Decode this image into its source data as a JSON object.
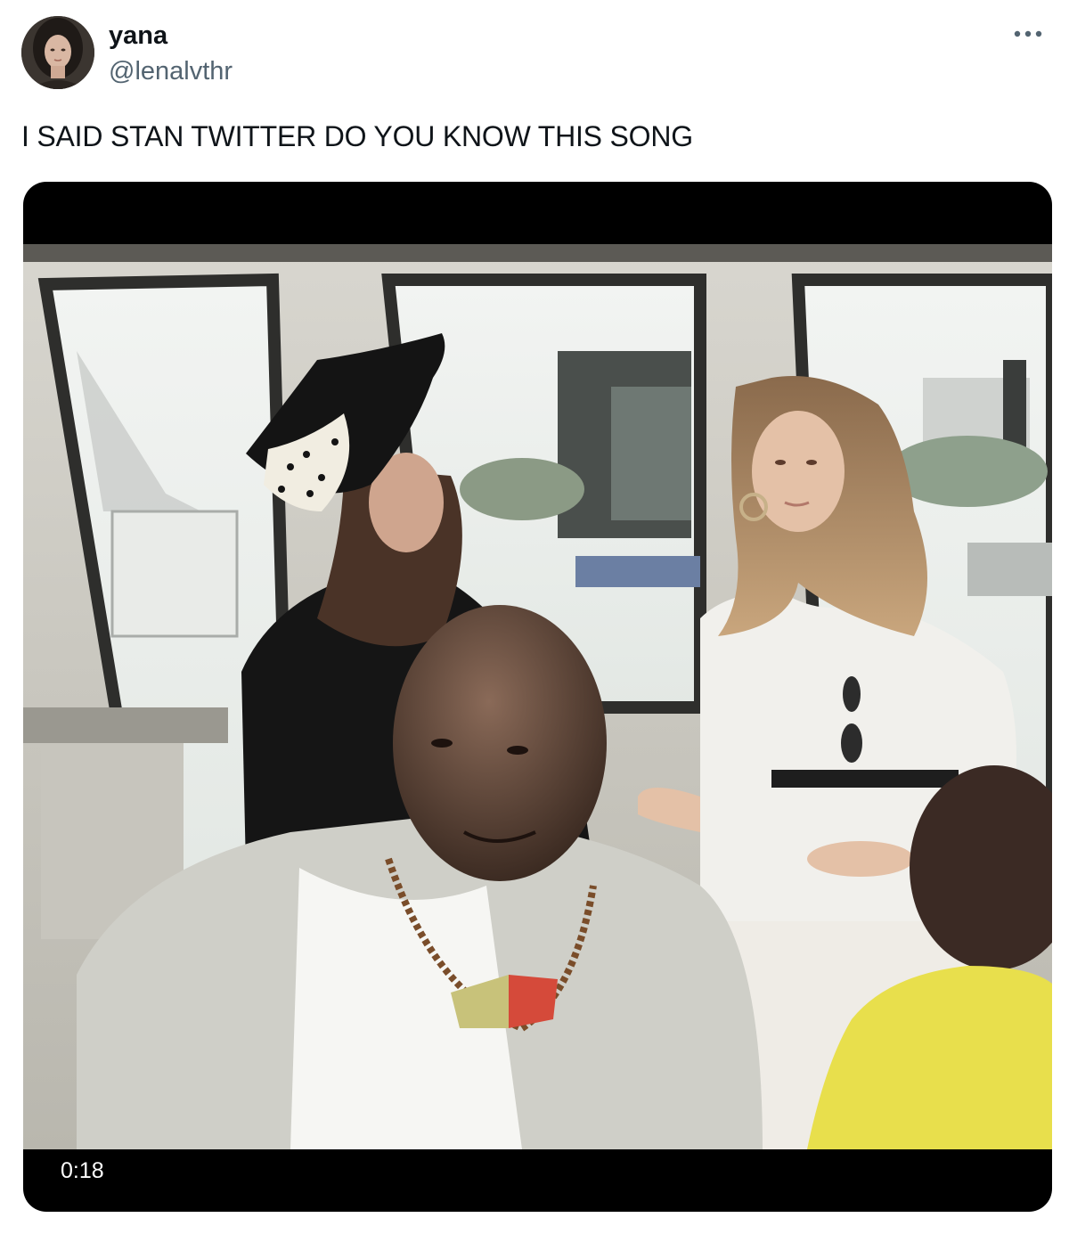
{
  "tweet": {
    "author": {
      "display_name": "yana",
      "handle": "@lenalvthr",
      "avatar_icon": "profile-photo"
    },
    "more_icon": "more-horizontal-icon",
    "text": "I SAID STAN TWITTER DO YOU KNOW THIS SONG",
    "media": {
      "type": "video",
      "duration": "0:18"
    }
  },
  "colors": {
    "text_primary": "#0f1419",
    "text_secondary": "#536471",
    "media_background": "#000000"
  }
}
